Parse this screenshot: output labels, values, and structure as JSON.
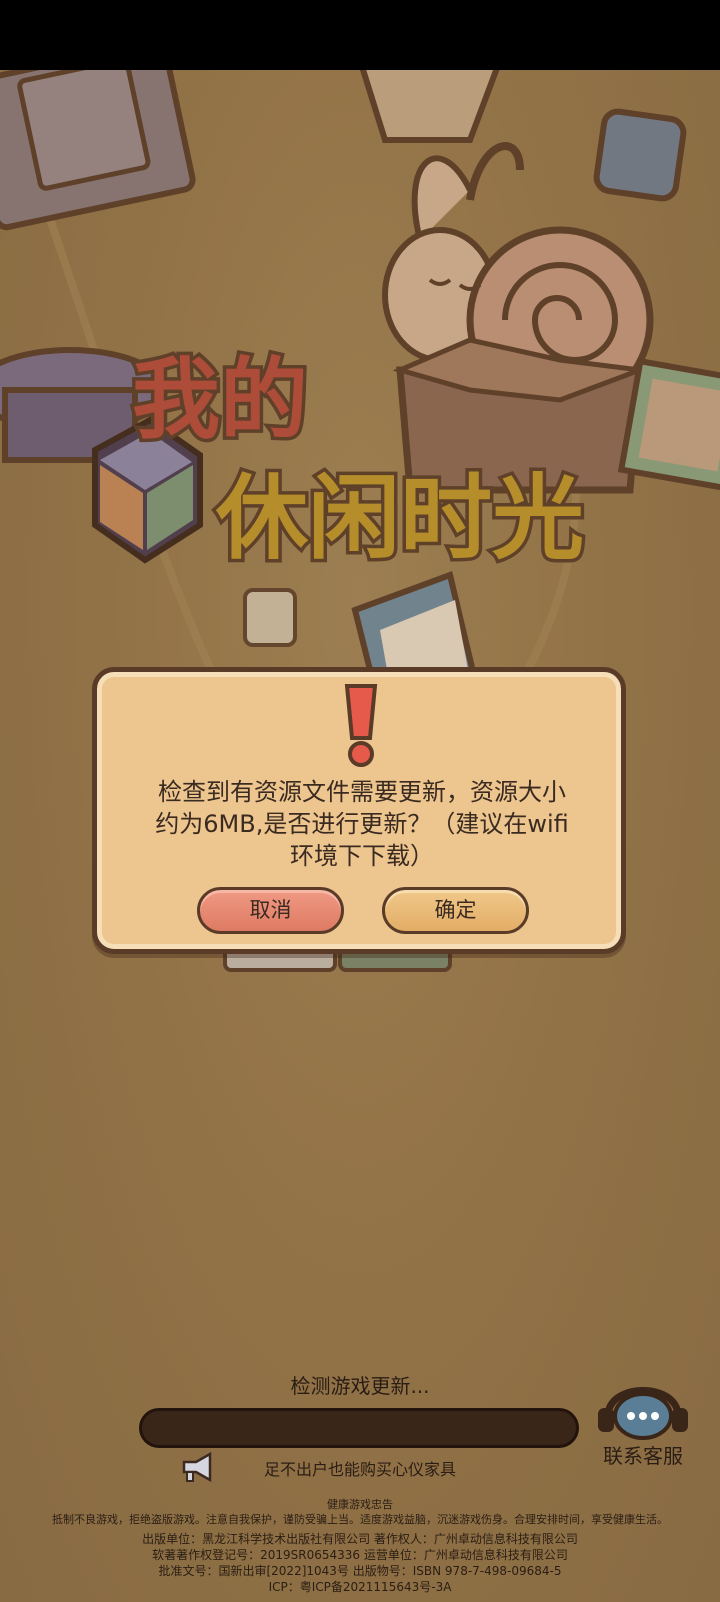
{
  "colors": {
    "background": "#98794c",
    "dialog_bg": "#ecc58f",
    "cancel_button": "#e58a73",
    "confirm_button": "#e8b977",
    "outline": "#5a3b28",
    "progress_track": "#3a2519"
  },
  "logo": {
    "line1": "我的",
    "line2": "休闲时光"
  },
  "dialog": {
    "icon": "exclamation-icon",
    "message_lines": [
      "检查到有资源文件需要更新，资源大小",
      "约为6MB,是否进行更新？（建议在wifi",
      "环境下下载）"
    ],
    "cancel_label": "取消",
    "confirm_label": "确定"
  },
  "loading": {
    "status_text": "检测游戏更新...",
    "progress_percent": 0,
    "tip_icon": "megaphone-icon",
    "tip_text": "足不出户也能购买心仪家具"
  },
  "support": {
    "icon": "headset-chat-icon",
    "label": "联系客服"
  },
  "footer": {
    "health_title": "健康游戏忠告",
    "health_text": "抵制不良游戏，拒绝盗版游戏。注意自我保护，谨防受骗上当。适度游戏益脑，沉迷游戏伤身。合理安排时间，享受健康生活。",
    "info_lines": [
      "出版单位：黑龙江科学技术出版社有限公司   著作权人：广州卓动信息科技有限公司",
      "软著著作权登记号：2019SR0654336   运营单位：广州卓动信息科技有限公司",
      "批准文号：国新出审[2022]1043号   出版物号：ISBN 978-7-498-09684-5",
      "ICP：粤ICP备2021115643号-3A"
    ]
  }
}
